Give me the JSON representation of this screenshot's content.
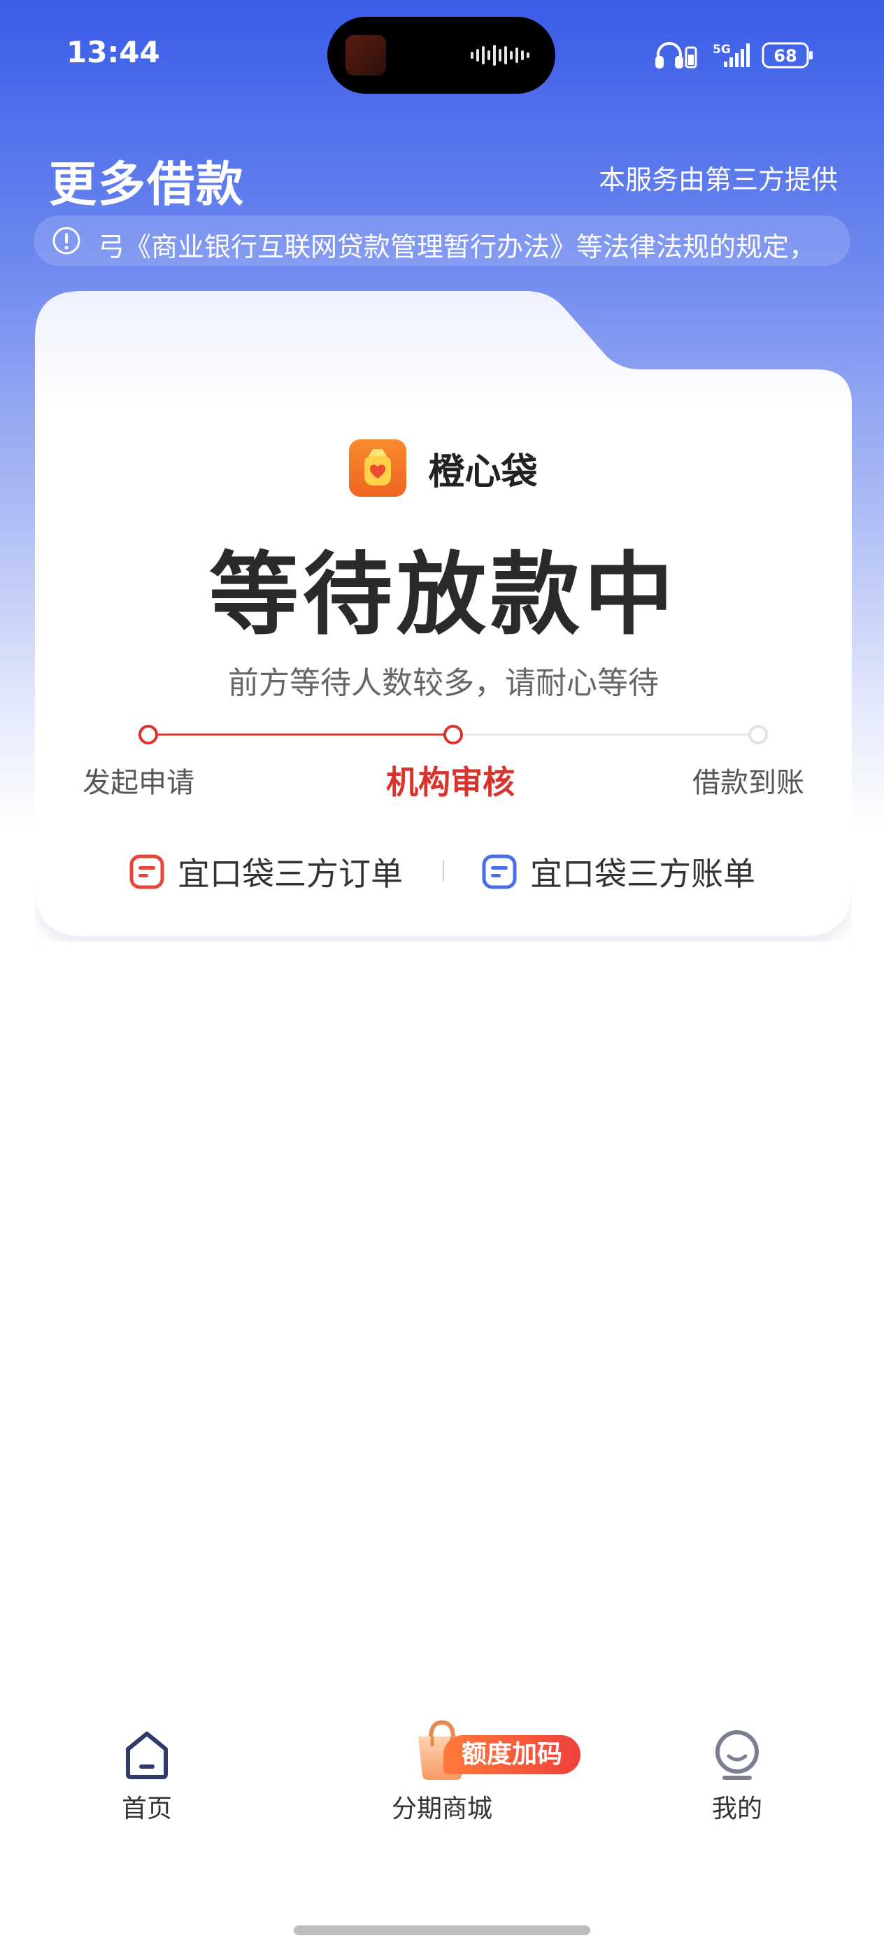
{
  "status_bar": {
    "time": "13:44",
    "network": "5G",
    "battery": "68"
  },
  "header": {
    "title": "更多借款",
    "provider_note": "本服务由第三方提供",
    "notice": "弓《商业银行互联网贷款管理暂行办法》等法律法规的规定，"
  },
  "card": {
    "brand_name": "橙心袋",
    "status_title": "等待放款中",
    "status_subtitle": "前方等待人数较多，请耐心等待",
    "steps": [
      {
        "label": "发起申请",
        "state": "done"
      },
      {
        "label": "机构审核",
        "state": "active"
      },
      {
        "label": "借款到账",
        "state": "pending"
      }
    ],
    "links": [
      {
        "label": "宜口袋三方订单",
        "icon": "order-icon",
        "color": "#e8453c"
      },
      {
        "label": "宜口袋三方账单",
        "icon": "bill-icon",
        "color": "#4a6ee8"
      }
    ]
  },
  "tabbar": {
    "items": [
      {
        "label": "首页",
        "icon": "home-icon"
      },
      {
        "label": "分期商城",
        "icon": "shopping-bag-icon"
      },
      {
        "label": "我的",
        "icon": "profile-icon"
      }
    ],
    "promo_badge": "额度加码"
  },
  "colors": {
    "header_blue": "#3a5ce8",
    "active_red": "#d8332c",
    "brand_orange": "#f07a2a"
  }
}
